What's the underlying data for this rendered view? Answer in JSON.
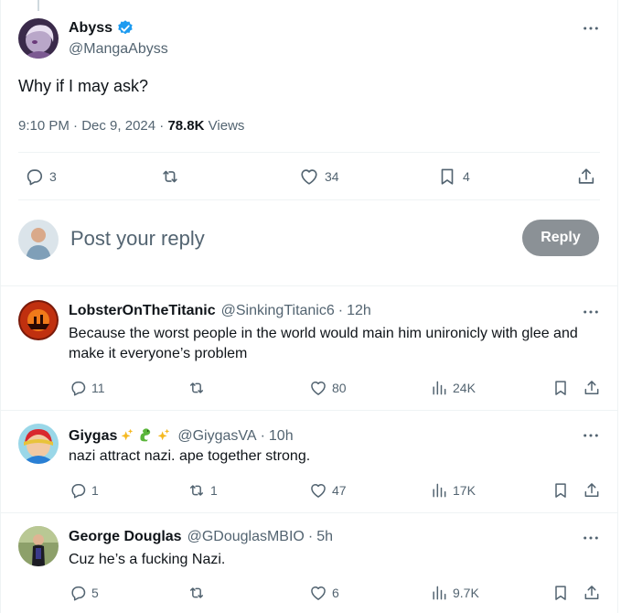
{
  "main_post": {
    "display_name": "Abyss",
    "handle": "@MangaAbyss",
    "text": "Why if I may ask?",
    "time": "9:10 PM",
    "date": "Dec 9, 2024",
    "views_count": "78.8K",
    "views_label": "Views",
    "actions": {
      "replies": "3",
      "reposts": "",
      "likes": "34",
      "bookmarks": "4"
    }
  },
  "reply_box": {
    "placeholder": "Post your reply",
    "button_label": "Reply"
  },
  "comments": [
    {
      "display_name": "LobsterOnTheTitanic",
      "handle": "@SinkingTitanic6",
      "age": "12h",
      "text": "Because the worst people in the world would main him unironicly with glee and make it everyone’s problem",
      "replies": "11",
      "reposts": "",
      "likes": "80",
      "views": "24K"
    },
    {
      "display_name": "Giygas",
      "handle": "@GiygasVA",
      "age": "10h",
      "text": "nazi attract nazi. ape together strong.",
      "replies": "1",
      "reposts": "1",
      "likes": "47",
      "views": "17K"
    },
    {
      "display_name": "George Douglas",
      "handle": "@GDouglasMBIO",
      "age": "5h",
      "text": "Cuz he’s a fucking Nazi.",
      "replies": "5",
      "reposts": "",
      "likes": "6",
      "views": "9.7K"
    }
  ],
  "separators": {
    "dot": "·"
  },
  "colors": {
    "verified": "#1d9bf0",
    "secondary_text": "#536471",
    "reply_button_disabled": "#8b9196"
  },
  "icons": [
    "more-icon",
    "verified-badge-icon",
    "reply-icon",
    "repost-icon",
    "like-icon",
    "bookmark-icon",
    "share-icon",
    "views-icon"
  ]
}
